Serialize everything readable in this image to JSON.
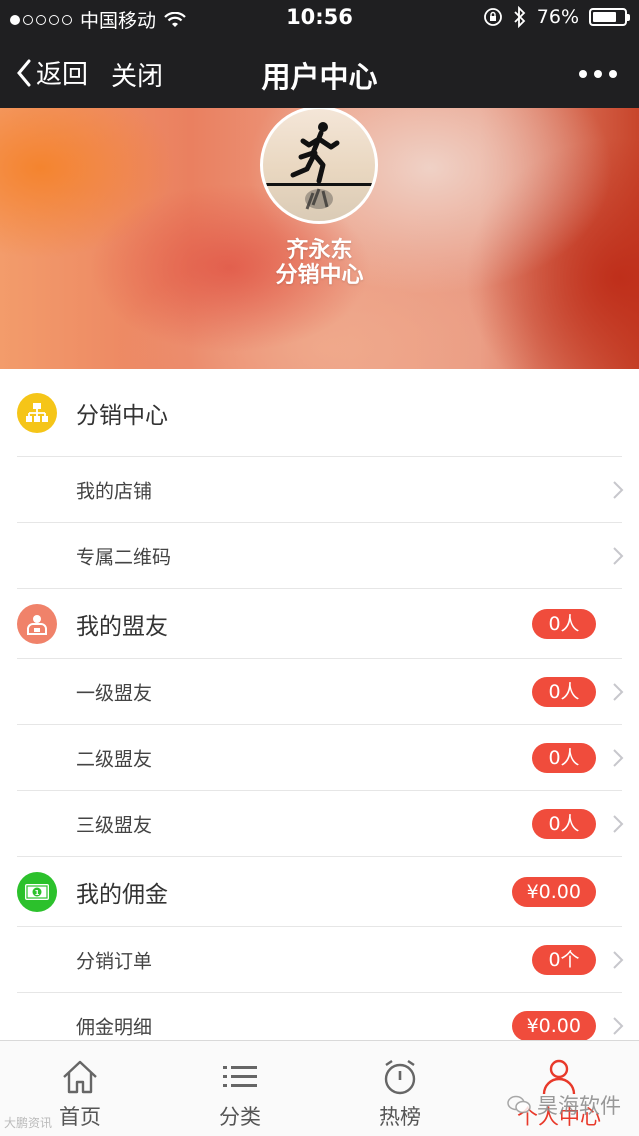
{
  "status": {
    "carrier": "中国移动",
    "time": "10:56",
    "battery": "76%",
    "battery_level": 0.76
  },
  "nav": {
    "back_label": "返回",
    "close_label": "关闭",
    "title": "用户中心"
  },
  "profile": {
    "name": "齐永东",
    "subtitle": "分销中心"
  },
  "sections": {
    "distribution": {
      "title": "分销中心",
      "icon": "org-chart-icon",
      "color": "#f5c518",
      "items": [
        {
          "label": "我的店铺"
        },
        {
          "label": "专属二维码"
        }
      ]
    },
    "allies": {
      "title": "我的盟友",
      "icon": "people-icon",
      "color": "#f0826a",
      "badge": "0人",
      "items": [
        {
          "label": "一级盟友",
          "badge": "0人"
        },
        {
          "label": "二级盟友",
          "badge": "0人"
        },
        {
          "label": "三级盟友",
          "badge": "0人"
        }
      ]
    },
    "commission": {
      "title": "我的佣金",
      "icon": "money-icon",
      "color": "#2cc12c",
      "badge": "¥0.00",
      "items": [
        {
          "label": "分销订单",
          "badge": "0个"
        },
        {
          "label": "佣金明细",
          "badge": "¥0.00"
        }
      ]
    }
  },
  "tabs": [
    {
      "label": "首页",
      "icon": "home-icon"
    },
    {
      "label": "分类",
      "icon": "list-icon"
    },
    {
      "label": "热榜",
      "icon": "alarm-clock-icon"
    },
    {
      "label": "个人中心",
      "icon": "user-icon",
      "active": true
    }
  ],
  "watermark": {
    "left": "大鹏资讯",
    "right": "昊海软件"
  },
  "colors": {
    "accent": "#f04c3c",
    "navbar": "#1f1f21",
    "tab_active": "#e8392a"
  }
}
